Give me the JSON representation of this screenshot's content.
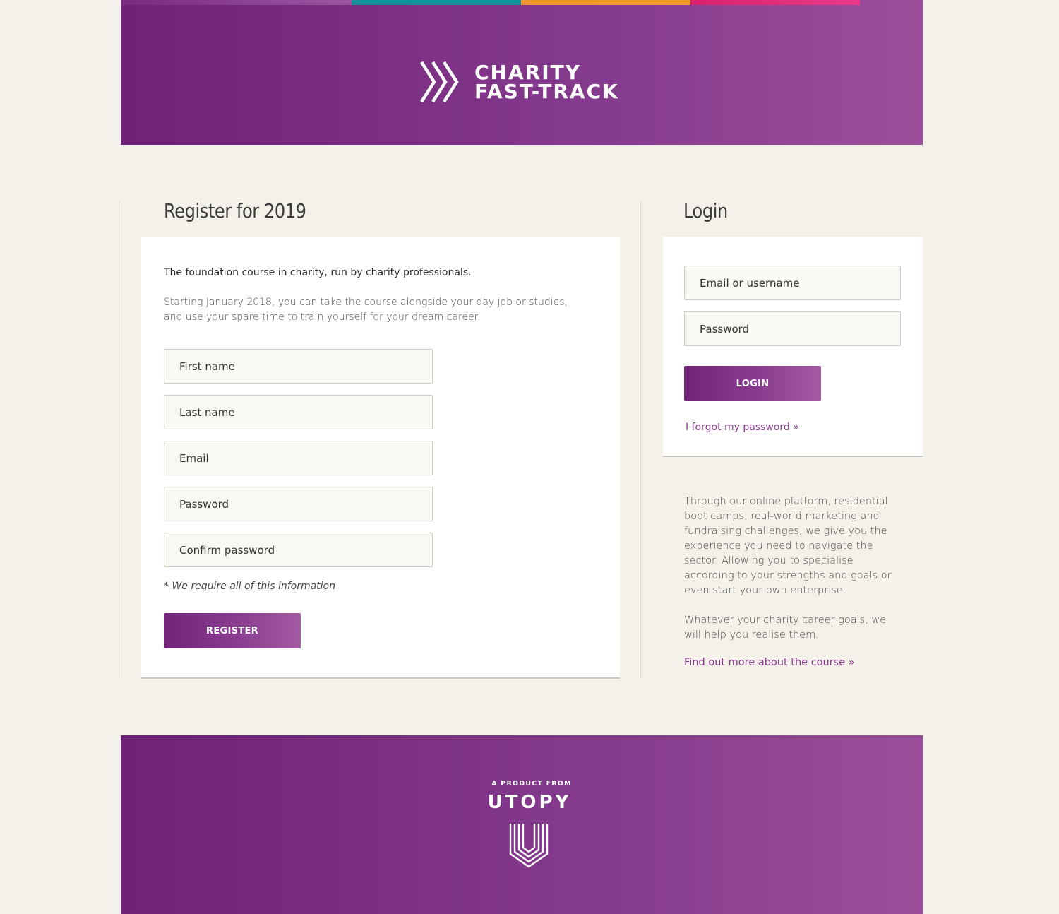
{
  "header": {
    "brand_line1": "CHARITY",
    "brand_line2": "FAST-TRACK",
    "brand_icon": "chevrons-icon",
    "stripe_colors": [
      "#7a2a82",
      "#13929a",
      "#f09a2b",
      "#e02c7c"
    ]
  },
  "register": {
    "title": "Register for 2019",
    "lead": "The foundation course in charity, run by charity professionals.",
    "intro": "Starting January 2018, you can take the course alongside your day job or studies, and use your spare time to train yourself for your dream career.",
    "fields": {
      "first_name": "First name",
      "last_name": "Last name",
      "email": "Email",
      "password": "Password",
      "confirm_password": "Confirm password"
    },
    "required_note": "*  We require all of this information",
    "button_label": "REGISTER"
  },
  "login": {
    "title": "Login",
    "fields": {
      "username": "Email or username",
      "password": "Password"
    },
    "button_label": "LOGIN",
    "forgot_link": "I forgot my password »"
  },
  "about": {
    "paragraph1": "Through our online platform, residential boot camps,  real-world marketing and fundraising challenges, we give you the experience you need to navigate the sector.  Allowing you to specialise according to your strengths and goals or even start your own enterprise.",
    "paragraph2": "Whatever your charity career goals, we will help you realise them.",
    "more_link": "Find out more about the course »"
  },
  "footer": {
    "product_from": "A PRODUCT FROM",
    "company": "UTOPY",
    "logo_icon": "utopy-u-icon"
  },
  "colors": {
    "brand_purple": "#7a2a82",
    "link_purple": "#8a3a8d",
    "page_bg": "#f4f1ea"
  }
}
